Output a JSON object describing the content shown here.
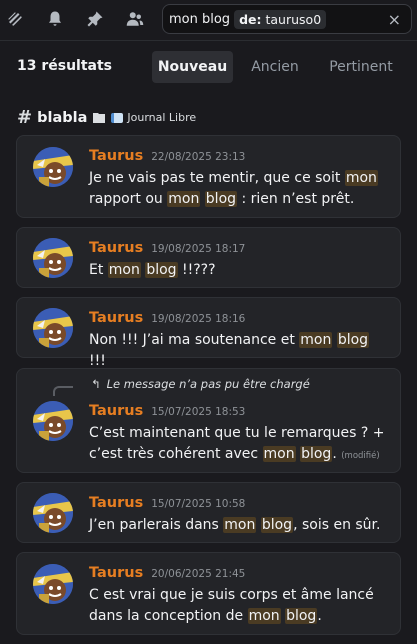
{
  "search": {
    "query": "mon blog",
    "filter_key": "de:",
    "filter_value": "tauruso0",
    "clear_icon": "×"
  },
  "results": {
    "count_label": "13 résultats",
    "sort_tabs": [
      "Nouveau",
      "Ancien",
      "Pertinent"
    ],
    "active_tab": "Nouveau"
  },
  "channel": {
    "name": "blabla",
    "category": "Journal Libre"
  },
  "messages": [
    {
      "author": "Taurus",
      "time": "22/08/2025 23:13",
      "parts": [
        {
          "t": "Je ne vais pas te mentir, que ce soit "
        },
        {
          "t": "mon",
          "hl": true
        },
        {
          "t": " rapport ou "
        },
        {
          "t": "mon",
          "hl": true
        },
        {
          "t": " "
        },
        {
          "t": "blog",
          "hl": true
        },
        {
          "t": " : rien n’est prêt."
        }
      ]
    },
    {
      "author": "Taurus",
      "time": "19/08/2025 18:17",
      "parts": [
        {
          "t": "Et "
        },
        {
          "t": "mon",
          "hl": true
        },
        {
          "t": " "
        },
        {
          "t": "blog",
          "hl": true
        },
        {
          "t": " !!???"
        }
      ]
    },
    {
      "author": "Taurus",
      "time": "19/08/2025 18:16",
      "parts": [
        {
          "t": "Non !!! J’ai ma soutenance et "
        },
        {
          "t": "mon",
          "hl": true
        },
        {
          "t": " "
        },
        {
          "t": "blog",
          "hl": true
        },
        {
          "t": " !!!"
        }
      ]
    },
    {
      "author": "Taurus",
      "time": "15/07/2025 18:53",
      "reply": "Le message n’a pas pu être chargé",
      "edited": "(modifié)",
      "parts": [
        {
          "t": "C’est maintenant que tu le remarques ? + c’est très cohérent avec "
        },
        {
          "t": "mon",
          "hl": true
        },
        {
          "t": " "
        },
        {
          "t": "blog",
          "hl": true
        },
        {
          "t": "."
        }
      ]
    },
    {
      "author": "Taurus",
      "time": "15/07/2025 10:58",
      "parts": [
        {
          "t": "J’en parlerais dans "
        },
        {
          "t": "mon",
          "hl": true
        },
        {
          "t": " "
        },
        {
          "t": "blog",
          "hl": true
        },
        {
          "t": ", sois en sûr."
        }
      ]
    },
    {
      "author": "Taurus",
      "time": "20/06/2025 21:45",
      "parts": [
        {
          "t": "C est vrai que je suis corps et âme lancé dans la conception de "
        },
        {
          "t": "mon",
          "hl": true
        },
        {
          "t": " "
        },
        {
          "t": "blog",
          "hl": true
        },
        {
          "t": "."
        }
      ]
    }
  ],
  "icons": {
    "threads": "threads-icon",
    "notifications": "bell-icon",
    "pins": "pin-icon",
    "members": "members-icon",
    "reply": "reply-arrow-icon",
    "folder": "folder-icon",
    "category": "book-icon"
  },
  "colors": {
    "author": "#e67e22",
    "highlight": "#4a3b23",
    "background": "#1a1a1e"
  }
}
